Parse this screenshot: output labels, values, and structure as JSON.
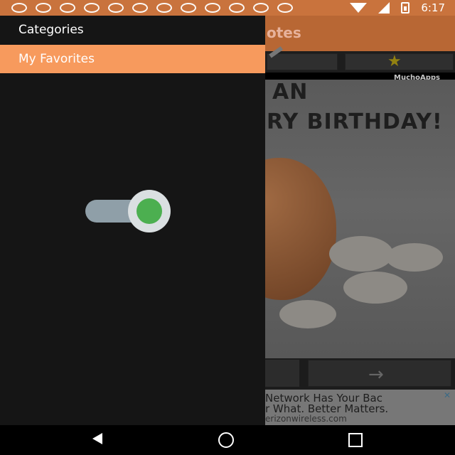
{
  "status_bar": {
    "time": "6:17",
    "icons": [
      "notification-icon",
      "notification-icon",
      "notification-icon",
      "notification-icon",
      "notification-icon",
      "notification-icon",
      "notification-icon",
      "notification-icon",
      "notification-icon",
      "notification-icon",
      "notification-icon",
      "notification-icon"
    ],
    "background_color": "#c9733d"
  },
  "app": {
    "title_fragment": "otes",
    "watermark": "MuchoApps",
    "photo_text_line1": "AN",
    "photo_text_line2": "RY BIRTHDAY!"
  },
  "ad": {
    "line1": "Network Has Your Bac",
    "line2": "r What. Better Matters.",
    "line3": "erizonwireless.com",
    "close_label": "✕"
  },
  "drawer": {
    "items": [
      {
        "label": "Categories",
        "selected": false
      },
      {
        "label": "My Favorites",
        "selected": true
      }
    ],
    "accent_color": "#f79a5d",
    "toggle": {
      "state": "on",
      "thumb_color": "#4caf50"
    }
  },
  "navigation": {
    "buttons": [
      "back-icon",
      "home-icon",
      "recent-apps-icon"
    ]
  }
}
